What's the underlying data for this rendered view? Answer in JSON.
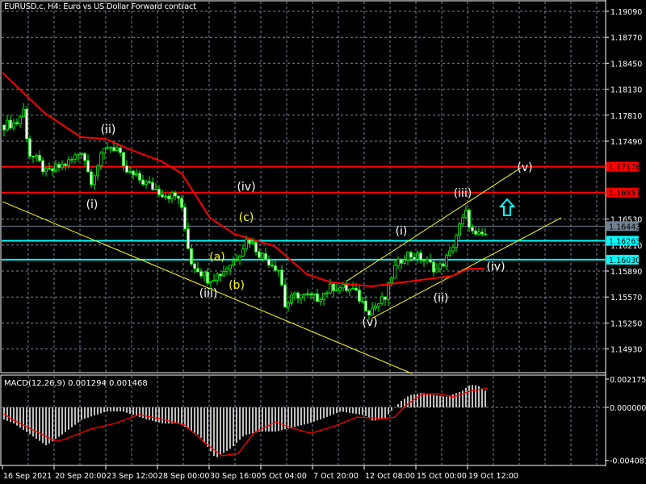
{
  "header": {
    "title": "EURUSD.c, H4:  Euro vs US Dollar Forward contract"
  },
  "macd_panel": {
    "title": "MACD(12,26,9) 0.001294 0.001468"
  },
  "colors": {
    "bull_outline": "#00ff00",
    "bear_body": "#ffffff",
    "ma": "#ff0000",
    "grid": "#778899",
    "trend": "#ffff00",
    "cyan": "#00ffff",
    "red_level": "#ff0000",
    "gray_level": "#708090",
    "macd_hist": "#c0c0c0",
    "macd_signal": "#ff0000"
  },
  "chart_data": {
    "type": "candlestick",
    "symbol": "EURUSD.c",
    "timeframe": "H4",
    "bar_count": 150,
    "ylim": [
      1.1477,
      1.1925
    ],
    "price_ticks": [
      1.1909,
      1.1877,
      1.1845,
      1.1813,
      1.1781,
      1.1749,
      1.1653,
      1.1621,
      1.1589,
      1.1557,
      1.1525,
      1.1493
    ],
    "price_tick_labels": [
      "1.19090",
      "1.18770",
      "1.18450",
      "1.18130",
      "1.17810",
      "1.17490",
      "1.16530",
      "1.16210",
      "1.15890",
      "1.15570",
      "1.15250",
      "1.14930"
    ],
    "time_labels": [
      {
        "bar": 0,
        "label": "16 Sep 2021"
      },
      {
        "bar": 16,
        "label": "20 Sep 20:00"
      },
      {
        "bar": 32,
        "label": "23 Sep 12:00"
      },
      {
        "bar": 48,
        "label": "28 Sep 00:00"
      },
      {
        "bar": 64,
        "label": "30 Sep 16:00"
      },
      {
        "bar": 80,
        "label": "5 Oct 04:00"
      },
      {
        "bar": 96,
        "label": "7 Oct 20:00"
      },
      {
        "bar": 112,
        "label": "12 Oct 08:00"
      },
      {
        "bar": 128,
        "label": "15 Oct 00:00"
      },
      {
        "bar": 144,
        "label": "19 Oct 12:00"
      }
    ],
    "close_path": [
      [
        0,
        1.17689
      ],
      [
        4,
        1.1772
      ],
      [
        6.25,
        1.17888
      ],
      [
        7.5,
        1.17341
      ],
      [
        10.5,
        1.17242
      ],
      [
        13,
        1.17093
      ],
      [
        20.5,
        1.17241
      ],
      [
        24.25,
        1.17391
      ],
      [
        26.75,
        1.16993
      ],
      [
        31.75,
        1.1744
      ],
      [
        35.5,
        1.17391
      ],
      [
        36.75,
        1.17142
      ],
      [
        43,
        1.16993
      ],
      [
        49.25,
        1.16844
      ],
      [
        54.25,
        1.16794
      ],
      [
        56.75,
        1.16248
      ],
      [
        58,
        1.16
      ],
      [
        63,
        1.15801
      ],
      [
        66.75,
        1.15851
      ],
      [
        71.75,
        1.16049
      ],
      [
        75.5,
        1.16298
      ],
      [
        79.25,
        1.16099
      ],
      [
        85.5,
        1.159
      ],
      [
        86.75,
        1.15453
      ],
      [
        90.5,
        1.15602
      ],
      [
        96.75,
        1.15552
      ],
      [
        101.75,
        1.15701
      ],
      [
        108,
        1.15652
      ],
      [
        113,
        1.15403
      ],
      [
        118,
        1.15552
      ],
      [
        120.5,
        1.159
      ],
      [
        124.25,
        1.16099
      ],
      [
        129.25,
        1.16049
      ],
      [
        134.25,
        1.159
      ],
      [
        138,
        1.16099
      ],
      [
        140.5,
        1.16397
      ],
      [
        143,
        1.16596
      ],
      [
        145.5,
        1.16298
      ],
      [
        149,
        1.16347
      ]
    ],
    "moving_average": [
      [
        0,
        1.18335
      ],
      [
        13,
        1.17838
      ],
      [
        24.25,
        1.1754
      ],
      [
        31.75,
        1.1752
      ],
      [
        39.25,
        1.17391
      ],
      [
        49.25,
        1.17242
      ],
      [
        55.5,
        1.17092
      ],
      [
        64.25,
        1.16546
      ],
      [
        71.75,
        1.16347
      ],
      [
        84.25,
        1.16198
      ],
      [
        94.25,
        1.1585
      ],
      [
        101.75,
        1.15751
      ],
      [
        114.25,
        1.15701
      ],
      [
        139.25,
        1.1583
      ],
      [
        144.25,
        1.1592
      ],
      [
        149.25,
        1.1592
      ]
    ],
    "levels": [
      {
        "price": 1.17176,
        "label": "1.17176",
        "kind": "red"
      },
      {
        "price": 1.16857,
        "label": "1.16857",
        "kind": "red"
      },
      {
        "price": 1.16443,
        "label": "1.16443",
        "kind": "gray"
      },
      {
        "price": 1.16263,
        "label": "1.16263",
        "kind": "cyan"
      },
      {
        "price": 1.1603,
        "label": "1.16030",
        "kind": "cyan"
      }
    ],
    "trendlines": [
      {
        "from": [
          0,
          1.16745
        ],
        "to": [
          126.75,
          1.14628
        ]
      },
      {
        "from": [
          106.75,
          1.15771
        ],
        "to": [
          160.5,
          1.17162
        ]
      },
      {
        "from": [
          114.25,
          1.15304
        ],
        "to": [
          173,
          1.16546
        ]
      }
    ],
    "wave_labels": [
      {
        "text": "(ii)",
        "color": "#ffffff",
        "bar": 32.75,
        "price": 1.17639
      },
      {
        "text": "(i)",
        "color": "#ffffff",
        "bar": 27.75,
        "price": 1.16715
      },
      {
        "text": "(iv)",
        "color": "#ffffff",
        "bar": 75.5,
        "price": 1.16934
      },
      {
        "text": "(c)",
        "color": "#ffff00",
        "bar": 75.5,
        "price": 1.16556
      },
      {
        "text": "(a)",
        "color": "#ffff00",
        "bar": 66.5,
        "price": 1.16069
      },
      {
        "text": "(b)",
        "color": "#ffff00",
        "bar": 72.5,
        "price": 1.15721
      },
      {
        "text": "(iii)",
        "color": "#ffffff",
        "bar": 63.75,
        "price": 1.15622
      },
      {
        "text": "(v)",
        "color": "#ffffff",
        "bar": 113.75,
        "price": 1.15264
      },
      {
        "text": "(i)",
        "color": "#ffffff",
        "bar": 123.5,
        "price": 1.16387
      },
      {
        "text": "(ii)",
        "color": "#ffffff",
        "bar": 135.75,
        "price": 1.15562
      },
      {
        "text": "(iii)",
        "color": "#ffffff",
        "bar": 142.5,
        "price": 1.16854
      },
      {
        "text": "(iv)",
        "color": "#ffffff",
        "bar": 152.75,
        "price": 1.1595
      },
      {
        "text": "(v)",
        "color": "#ffffff",
        "bar": 161.75,
        "price": 1.17172
      }
    ],
    "up_arrow": {
      "bar": 156.25,
      "price": 1.16675
    },
    "macd": {
      "params": "12,26,9",
      "macd_value": 0.001294,
      "signal_value": 0.001468,
      "ylim": [
        -0.004081,
        0.002175
      ],
      "tick_labels": [
        "0.002175",
        "0.000000",
        "-0.004081"
      ],
      "ticks": [
        0.002175,
        0,
        -0.004081
      ],
      "histogram_path": [
        [
          0,
          -0.00093
        ],
        [
          3,
          -0.00124
        ],
        [
          6.75,
          -0.00186
        ],
        [
          13,
          -0.00292
        ],
        [
          14.75,
          -0.00267
        ],
        [
          19.25,
          -0.00186
        ],
        [
          24.25,
          -0.00093
        ],
        [
          31.75,
          -0.00031
        ],
        [
          36.75,
          -0.00031
        ],
        [
          40.5,
          -0.00062
        ],
        [
          44.25,
          -0.00093
        ],
        [
          49.25,
          -0.00124
        ],
        [
          54.25,
          -0.00124
        ],
        [
          60.5,
          -0.00217
        ],
        [
          65.5,
          -0.00391
        ],
        [
          70.5,
          -0.00311
        ],
        [
          74.25,
          -0.00217
        ],
        [
          79.25,
          -0.00186
        ],
        [
          84.25,
          -0.00186
        ],
        [
          89.25,
          -0.00155
        ],
        [
          94.25,
          -0.00124
        ],
        [
          99.25,
          -0.00081
        ],
        [
          104.25,
          -0.00031
        ],
        [
          111.75,
          -0.00062
        ],
        [
          114.25,
          -0.00106
        ],
        [
          118,
          -0.00081
        ],
        [
          120.5,
          -0.00012
        ],
        [
          123,
          0.0005
        ],
        [
          125.5,
          0.00093
        ],
        [
          129.25,
          0.00112
        ],
        [
          136.75,
          0.00081
        ],
        [
          141.75,
          0.00124
        ],
        [
          144.25,
          0.00174
        ],
        [
          146.75,
          0.00168
        ],
        [
          149,
          0.00129
        ]
      ],
      "signal_path": [
        [
          0,
          -0.0005
        ],
        [
          2.5,
          -0.00093
        ],
        [
          7.5,
          -0.00155
        ],
        [
          16,
          -0.00261
        ],
        [
          18.5,
          -0.00248
        ],
        [
          26.75,
          -0.00168
        ],
        [
          34.25,
          -0.00124
        ],
        [
          41.75,
          -0.00056
        ],
        [
          49.25,
          -0.00093
        ],
        [
          56,
          -0.00137
        ],
        [
          62.5,
          -0.00279
        ],
        [
          67.5,
          -0.00373
        ],
        [
          72.5,
          -0.00354
        ],
        [
          77.5,
          -0.00193
        ],
        [
          84.25,
          -0.00112
        ],
        [
          89.25,
          -0.00161
        ],
        [
          95,
          -0.00199
        ],
        [
          102.5,
          -0.00143
        ],
        [
          109.25,
          -0.00075
        ],
        [
          117.5,
          -0.00087
        ],
        [
          121,
          -0.00075
        ],
        [
          124.25,
          0.00012
        ],
        [
          129.25,
          0.00099
        ],
        [
          134.25,
          0.00106
        ],
        [
          139.25,
          0.00081
        ],
        [
          144.25,
          0.00124
        ],
        [
          149.75,
          0.00147
        ]
      ]
    }
  }
}
